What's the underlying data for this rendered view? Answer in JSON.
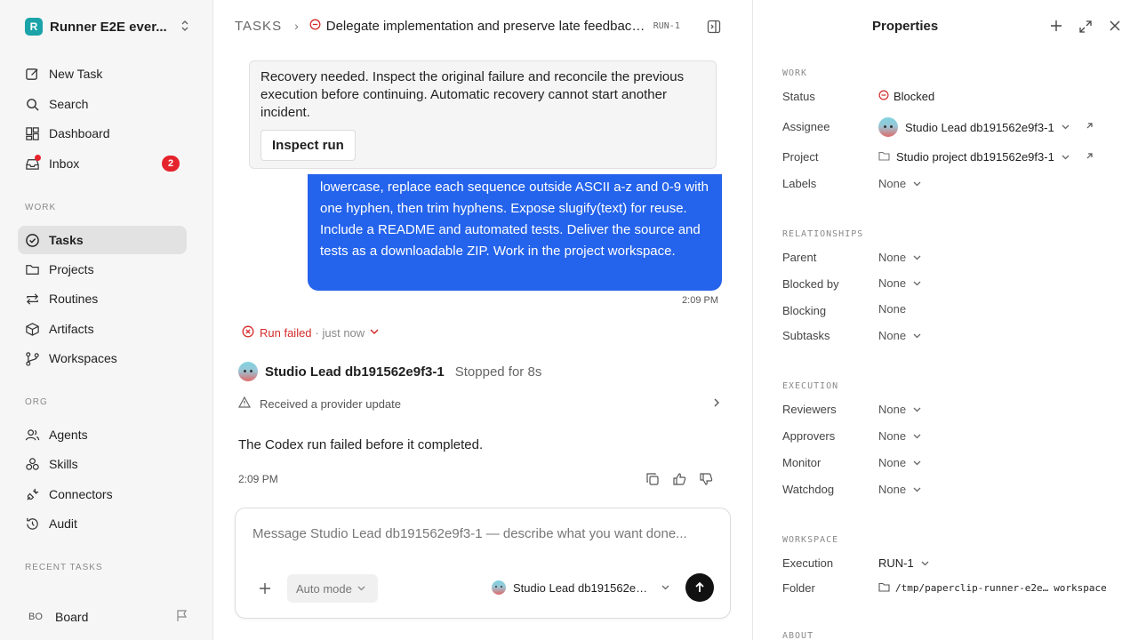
{
  "workspace": {
    "logo_letter": "R",
    "name": "Runner E2E ever...",
    "switch_icon": "chevrons-up-down-icon"
  },
  "sidebar": {
    "top_items": [
      {
        "label": "New Task",
        "icon": "pencil-square-icon"
      },
      {
        "label": "Search",
        "icon": "search-icon"
      },
      {
        "label": "Dashboard",
        "icon": "dashboard-icon"
      },
      {
        "label": "Inbox",
        "icon": "inbox-icon",
        "badge": "2"
      }
    ],
    "work_heading": "WORK",
    "work_items": [
      {
        "label": "Tasks",
        "icon": "check-circle-icon",
        "active": true
      },
      {
        "label": "Projects",
        "icon": "folder-icon"
      },
      {
        "label": "Routines",
        "icon": "repeat-icon"
      },
      {
        "label": "Artifacts",
        "icon": "box-icon"
      },
      {
        "label": "Workspaces",
        "icon": "branch-icon"
      }
    ],
    "org_heading": "ORG",
    "org_items": [
      {
        "label": "Agents",
        "icon": "users-icon"
      },
      {
        "label": "Skills",
        "icon": "skills-icon"
      },
      {
        "label": "Connectors",
        "icon": "plug-icon"
      },
      {
        "label": "Audit",
        "icon": "history-icon"
      }
    ],
    "recent_heading": "RECENT TASKS",
    "board": {
      "initials": "BO",
      "label": "Board"
    }
  },
  "header": {
    "root": "TASKS",
    "title": "Delegate implementation and preserve late feedback...",
    "run_id": "RUN-1"
  },
  "recovery": {
    "text": "Recovery needed. Inspect the original failure and reconcile the previous execution before continuing. Automatic recovery cannot start another incident.",
    "button": "Inspect run"
  },
  "user_message": {
    "text": "lowercase, replace each sequence outside ASCII a-z and 0-9 with one hyphen, then trim hyphens. Expose slugify(text) for reuse. Include a README and automated tests. Deliver the source and tests as a downloadable ZIP. Work in the project workspace.",
    "time": "2:09 PM"
  },
  "run": {
    "status": "Run failed",
    "when": "· just now"
  },
  "agent_reply": {
    "name": "Studio Lead db191562e9f3-1",
    "stopped": "Stopped for 8s",
    "update": "Received a provider update",
    "result": "The Codex run failed before it completed.",
    "time": "2:09 PM"
  },
  "composer": {
    "placeholder": "Message Studio Lead db191562e9f3-1 — describe what you want done...",
    "mode": "Auto mode",
    "agent": "Studio Lead db191562e9f..."
  },
  "properties": {
    "title": "Properties",
    "sections": {
      "work": "WORK",
      "relationships": "RELATIONSHIPS",
      "execution": "EXECUTION",
      "workspace": "WORKSPACE",
      "about": "ABOUT"
    },
    "status": {
      "label": "Status",
      "value": "Blocked",
      "color": "#d52b2b"
    },
    "assignee": {
      "label": "Assignee",
      "value": "Studio Lead db191562e9f3-1"
    },
    "project": {
      "label": "Project",
      "value": "Studio project db191562e9f3-1"
    },
    "labels": {
      "label": "Labels",
      "value": "None"
    },
    "parent": {
      "label": "Parent",
      "value": "None"
    },
    "blocked_by": {
      "label": "Blocked by",
      "value": "None"
    },
    "blocking": {
      "label": "Blocking",
      "value": "None"
    },
    "subtasks": {
      "label": "Subtasks",
      "value": "None"
    },
    "reviewers": {
      "label": "Reviewers",
      "value": "None"
    },
    "approvers": {
      "label": "Approvers",
      "value": "None"
    },
    "monitor": {
      "label": "Monitor",
      "value": "None"
    },
    "watchdog": {
      "label": "Watchdog",
      "value": "None"
    },
    "execution_ws": {
      "label": "Execution",
      "value": "RUN-1"
    },
    "folder": {
      "label": "Folder",
      "path": "/tmp/paperclip-runner-e2e…",
      "suffix": "workspace"
    }
  },
  "colors": {
    "accent": "#2463eb",
    "danger": "#d52b2b",
    "badge": "#e5232c"
  }
}
